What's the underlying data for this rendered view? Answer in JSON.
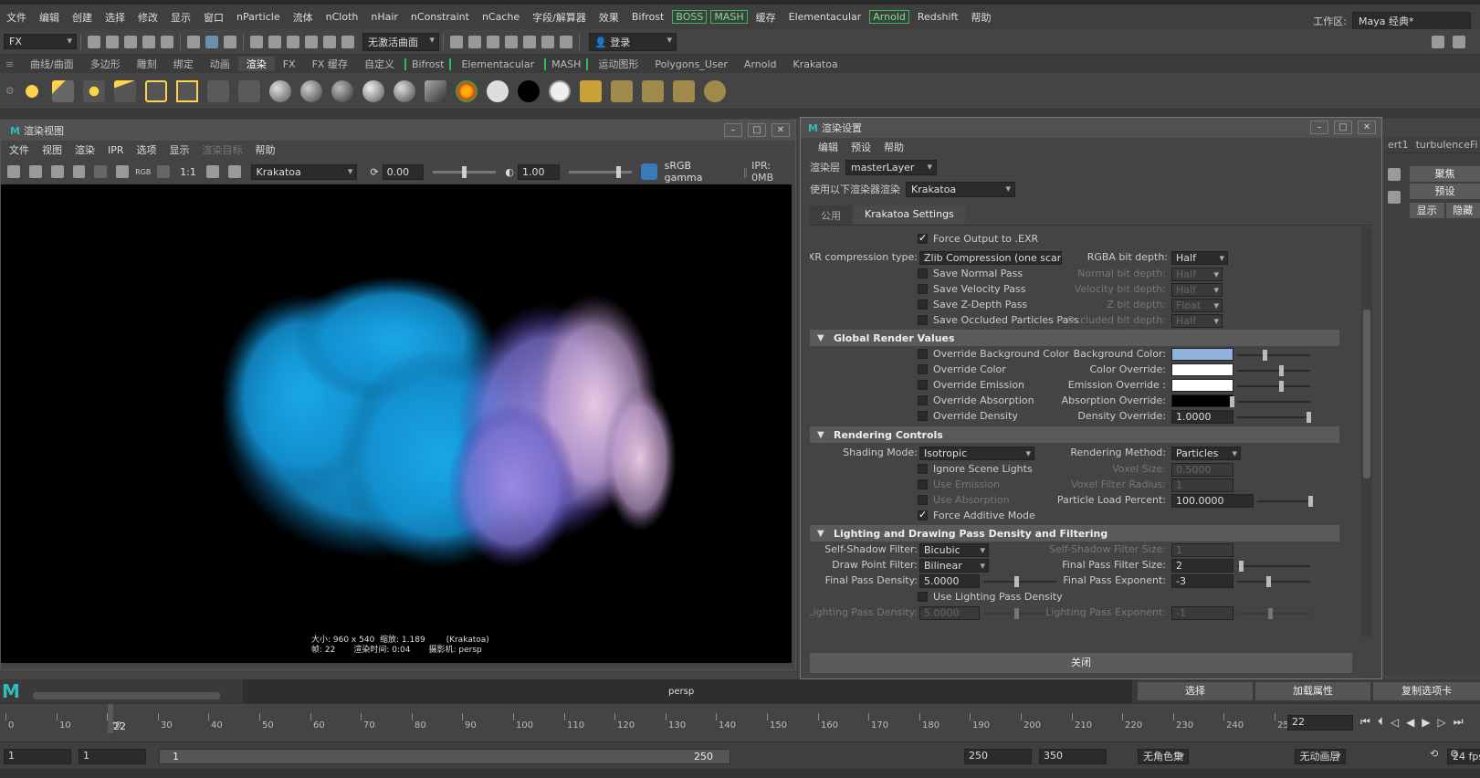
{
  "menubar": {
    "items": [
      "文件",
      "编辑",
      "创建",
      "选择",
      "修改",
      "显示",
      "窗口",
      "nParticle",
      "流体",
      "nCloth",
      "nHair",
      "nConstraint",
      "nCache",
      "字段/解算器",
      "效果",
      "Bifrost"
    ],
    "boxed": [
      "BOSS",
      "MASH"
    ],
    "items2": [
      "缓存",
      "Elementacular"
    ],
    "boxed2": [
      "Arnold"
    ],
    "items3": [
      "Redshift",
      "帮助"
    ],
    "workspace_label": "工作区:",
    "workspace_value": "Maya 经典*"
  },
  "toolbar": {
    "mode": "FX",
    "live_surface": "无激活曲面",
    "login": "登录"
  },
  "shelf_tabs": {
    "items": [
      "曲线/曲面",
      "多边形",
      "雕刻",
      "绑定",
      "动画"
    ],
    "active": "渲染",
    "items2": [
      "FX",
      "FX 缓存",
      "自定义"
    ],
    "boxed": [
      "Bifrost",
      "MASH"
    ],
    "between": "Elementacular",
    "items3": [
      "运动图形",
      "Polygons_User",
      "Arnold",
      "Krakatoa"
    ]
  },
  "render_view": {
    "title": "渲染视图",
    "menus": [
      "文件",
      "视图",
      "渲染",
      "IPR",
      "选项",
      "显示"
    ],
    "menus_disabled": [
      "渲染目标"
    ],
    "menus_last": [
      "帮助"
    ],
    "ratio": "1:1",
    "rgb": "RGB",
    "renderer": "Krakatoa",
    "exposure": "0.00",
    "gamma": "1.00",
    "color_space": "sRGB gamma",
    "ipr": "IPR: 0MB",
    "info": "大小: 960 x 540  缩放: 1.189        (Krakatoa)\n帧: 22       渲染时间: 0:04       摄影机: persp"
  },
  "render_settings": {
    "title": "渲染设置",
    "menus": [
      "编辑",
      "预设",
      "帮助"
    ],
    "layer_label": "渲染层",
    "layer_value": "masterLayer",
    "renderer_label": "使用以下渲染器渲染",
    "renderer_value": "Krakatoa",
    "tabs": [
      "公用",
      "Krakatoa Settings"
    ],
    "force_exr": "Force Output to .EXR",
    "exr_label": "EXR compression type:",
    "exr_value": "Zlib Compression (one scan line)",
    "rgba_label": "RGBA bit depth:",
    "rgba_value": "Half",
    "passes": [
      "Save Normal Pass",
      "Save Velocity Pass",
      "Save Z-Depth Pass",
      "Save Occluded Particles Pass"
    ],
    "pass_depths": [
      {
        "label": "Normal bit depth:",
        "value": "Half"
      },
      {
        "label": "Velocity bit depth:",
        "value": "Half"
      },
      {
        "label": "Z bit depth:",
        "value": "Float"
      },
      {
        "label": "Occluded bit depth:",
        "value": "Half"
      }
    ],
    "sec_global": "Global Render Values",
    "overrides": [
      "Override Background Color",
      "Override Color",
      "Override Emission",
      "Override Absorption",
      "Override Density"
    ],
    "override_fields": [
      {
        "label": "Background Color:",
        "color": "#8fb3dc"
      },
      {
        "label": "Color Override:",
        "color": "#ffffff"
      },
      {
        "label": "Emission Override :",
        "color": "#ffffff"
      },
      {
        "label": "Absorption Override:",
        "color": "#000000"
      }
    ],
    "density_label": "Density Override:",
    "density_value": "1.0000",
    "sec_rendering": "Rendering Controls",
    "shading_label": "Shading Mode:",
    "shading_value": "Isotropic",
    "method_label": "Rendering Method:",
    "method_value": "Particles",
    "ignore_lights": "Ignore Scene Lights",
    "use_emission": "Use Emission",
    "use_absorption": "Use Absorption",
    "force_additive": "Force Additive Mode",
    "voxel_size_label": "Voxel Size:",
    "voxel_size_value": "0.5000",
    "voxel_radius_label": "Voxel Filter Radius:",
    "voxel_radius_value": "1",
    "load_label": "Particle Load Percent:",
    "load_value": "100.0000",
    "sec_lighting": "Lighting and Drawing Pass Density and Filtering",
    "self_shadow_label": "Self-Shadow Filter:",
    "self_shadow_value": "Bicubic",
    "self_shadow_size_label": "Self-Shadow Filter Size:",
    "self_shadow_size_value": "1",
    "draw_point_label": "Draw Point Filter:",
    "draw_point_value": "Bilinear",
    "final_size_label": "Final Pass Filter Size:",
    "final_size_value": "2",
    "final_density_label": "Final Pass Density:",
    "final_density_value": "5.0000",
    "final_exp_label": "Final Pass Exponent:",
    "final_exp_value": "-3",
    "use_lighting_density": "Use Lighting Pass Density",
    "lighting_density_label": "Lighting Pass Density:",
    "lighting_density_value": "5.0000",
    "lighting_exp_label": "Lighting Pass Exponent:",
    "lighting_exp_value": "-1",
    "close": "关闭"
  },
  "right_panel": {
    "tabs": [
      "ert1",
      "turbulenceFi"
    ],
    "buttons": [
      "聚焦",
      "预设"
    ],
    "show": "显示",
    "hide": "隐藏"
  },
  "timeline": {
    "camera": "persp",
    "select": "选择",
    "load_attr": "加载属性",
    "copy_tab": "复制选项卡",
    "ticks": [
      0,
      10,
      20,
      30,
      40,
      50,
      60,
      70,
      80,
      90,
      100,
      110,
      120,
      130,
      140,
      150,
      160,
      170,
      180,
      190,
      200,
      210,
      220,
      230,
      240,
      250
    ],
    "current_frame": "22",
    "frame_field": "22",
    "range_start": "1",
    "range_start2": "1",
    "range_inner_start": "1",
    "range_inner_end": "250",
    "range_end": "250",
    "range_end2": "350",
    "char_set": "无角色集",
    "anim_layer": "无动画层",
    "fps": "24 fps"
  }
}
